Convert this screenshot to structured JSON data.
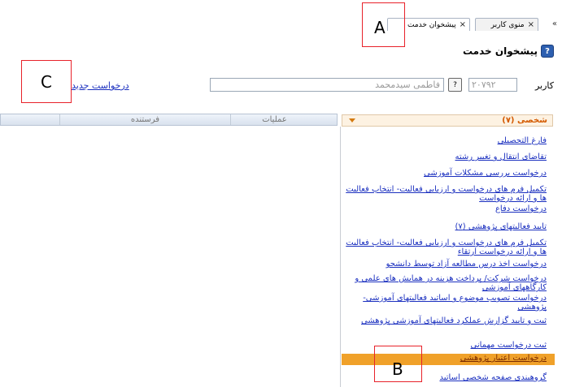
{
  "tabs": [
    {
      "label": "منوی کاربر",
      "close": "×"
    },
    {
      "label": "پیشخوان خدمت",
      "close": "×"
    }
  ],
  "chevron": "«",
  "page": {
    "title": "پیشخوان خدمت",
    "help": "?"
  },
  "user": {
    "label": "کاربر",
    "code": "۲۰۷۹۲",
    "lookup": "?",
    "name": "فاطمی سیدمحمد",
    "new_request": "درخواست جدید"
  },
  "grid": {
    "columns": [
      "فرستنده",
      "عملیات"
    ]
  },
  "panel": {
    "title": "شخصی (۷)",
    "items": [
      "فارغ التحصیلی",
      "تقاضای انتقال و تغییر رشته",
      "درخواست بررسی مشکلات آموزشی",
      "تکمیل فرم های درخواست و ارزیابی فعالیت- انتخاب فعالیت ها و ارائه درخواست",
      "درخواست دفاع",
      "تایید فعالیتهای پژوهشی (۷)",
      "تکمیل فرم های درخواست و ارزیابی فعالیت- انتخاب فعالیت ها و ارائه درخواست ارتقاء",
      "درخواست اخذ درس مطالعه آزاد توسط دانشجو",
      "درخواست شرکت/ پرداخت هزینه در همایش های علمی و کارگاههای آموزشی",
      "درخواست تصویب موضوع و اساتید فعالیتهای آموزشی-پژوهشی",
      "ثبت و تایید گزارش عملکرد فعالیتهای آموزشی پژوهشی",
      "ثبت درخواست مهمانی",
      "درخواست اعتبار پژوهشی",
      "گروهبندی صفحه شخصی اساتید"
    ]
  },
  "annotations": {
    "a": "A",
    "b": "B",
    "c": "C"
  },
  "colors": {
    "accent": "#f0a12a",
    "link": "#1a2fbf",
    "panel_title": "#d45a00",
    "annotation": "#e8222a"
  }
}
